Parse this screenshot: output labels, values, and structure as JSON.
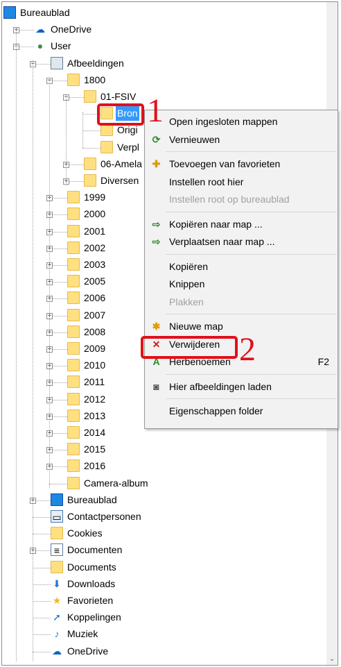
{
  "tree": {
    "items": [
      {
        "label": "Bureaublad",
        "icon": "desktop-icon",
        "level": 0,
        "expander": "",
        "selected": false
      },
      {
        "label": "OneDrive",
        "icon": "onedrive-cloud-icon",
        "level": 1,
        "expander": "+",
        "selected": false
      },
      {
        "label": "User",
        "icon": "user-icon",
        "level": 1,
        "expander": "-",
        "selected": false
      },
      {
        "label": "Afbeeldingen",
        "icon": "pictures-folder-icon",
        "level": 2,
        "expander": "-",
        "selected": false
      },
      {
        "label": "1800",
        "icon": "folder-icon",
        "level": 3,
        "expander": "-",
        "selected": false
      },
      {
        "label": "01-FSIV",
        "icon": "folder-icon",
        "level": 4,
        "expander": "-",
        "selected": false
      },
      {
        "label": "Bron",
        "icon": "folder-icon",
        "level": 5,
        "expander": "",
        "selected": true
      },
      {
        "label": "Origi",
        "icon": "folder-icon",
        "level": 5,
        "expander": "",
        "selected": false
      },
      {
        "label": "Verpl",
        "icon": "folder-icon",
        "level": 5,
        "expander": "",
        "selected": false
      },
      {
        "label": "06-Amela",
        "icon": "folder-icon",
        "level": 4,
        "expander": "+",
        "selected": false
      },
      {
        "label": "Diversen",
        "icon": "folder-icon",
        "level": 4,
        "expander": "+",
        "selected": false
      },
      {
        "label": "1999",
        "icon": "folder-icon",
        "level": 3,
        "expander": "+",
        "selected": false
      },
      {
        "label": "2000",
        "icon": "folder-icon",
        "level": 3,
        "expander": "+",
        "selected": false
      },
      {
        "label": "2001",
        "icon": "folder-icon",
        "level": 3,
        "expander": "+",
        "selected": false
      },
      {
        "label": "2002",
        "icon": "folder-icon",
        "level": 3,
        "expander": "+",
        "selected": false
      },
      {
        "label": "2003",
        "icon": "folder-icon",
        "level": 3,
        "expander": "+",
        "selected": false
      },
      {
        "label": "2005",
        "icon": "folder-icon",
        "level": 3,
        "expander": "+",
        "selected": false
      },
      {
        "label": "2006",
        "icon": "folder-icon",
        "level": 3,
        "expander": "+",
        "selected": false
      },
      {
        "label": "2007",
        "icon": "folder-icon",
        "level": 3,
        "expander": "+",
        "selected": false
      },
      {
        "label": "2008",
        "icon": "folder-icon",
        "level": 3,
        "expander": "+",
        "selected": false
      },
      {
        "label": "2009",
        "icon": "folder-icon",
        "level": 3,
        "expander": "+",
        "selected": false
      },
      {
        "label": "2010",
        "icon": "folder-icon",
        "level": 3,
        "expander": "+",
        "selected": false
      },
      {
        "label": "2011",
        "icon": "folder-icon",
        "level": 3,
        "expander": "+",
        "selected": false
      },
      {
        "label": "2012",
        "icon": "folder-icon",
        "level": 3,
        "expander": "+",
        "selected": false
      },
      {
        "label": "2013",
        "icon": "folder-icon",
        "level": 3,
        "expander": "+",
        "selected": false
      },
      {
        "label": "2014",
        "icon": "folder-icon",
        "level": 3,
        "expander": "+",
        "selected": false
      },
      {
        "label": "2015",
        "icon": "folder-icon",
        "level": 3,
        "expander": "+",
        "selected": false
      },
      {
        "label": "2016",
        "icon": "folder-icon",
        "level": 3,
        "expander": "+",
        "selected": false
      },
      {
        "label": "Camera-album",
        "icon": "folder-icon",
        "level": 3,
        "expander": "",
        "selected": false
      },
      {
        "label": "Bureaublad",
        "icon": "desktop-icon",
        "level": 2,
        "expander": "+",
        "selected": false
      },
      {
        "label": "Contactpersonen",
        "icon": "contacts-icon",
        "level": 2,
        "expander": "",
        "selected": false
      },
      {
        "label": "Cookies",
        "icon": "folder-icon",
        "level": 2,
        "expander": "",
        "selected": false
      },
      {
        "label": "Documenten",
        "icon": "documents-icon",
        "level": 2,
        "expander": "+",
        "selected": false
      },
      {
        "label": "Documents",
        "icon": "folder-icon",
        "level": 2,
        "expander": "",
        "selected": false
      },
      {
        "label": "Downloads",
        "icon": "downloads-icon",
        "level": 2,
        "expander": "",
        "selected": false
      },
      {
        "label": "Favorieten",
        "icon": "favorites-star-icon",
        "level": 2,
        "expander": "",
        "selected": false
      },
      {
        "label": "Koppelingen",
        "icon": "links-icon",
        "level": 2,
        "expander": "",
        "selected": false
      },
      {
        "label": "Muziek",
        "icon": "music-icon",
        "level": 2,
        "expander": "",
        "selected": false
      },
      {
        "label": "OneDrive",
        "icon": "onedrive-cloud-icon",
        "level": 2,
        "expander": "",
        "selected": false
      }
    ]
  },
  "context_menu": {
    "items": [
      {
        "type": "item",
        "label": "Open ingesloten mappen",
        "icon": "",
        "key": "",
        "disabled": false,
        "name": "menu-open-subfolders"
      },
      {
        "type": "item",
        "label": "Vernieuwen",
        "icon": "refresh-icon",
        "key": "",
        "disabled": false,
        "name": "menu-refresh"
      },
      {
        "type": "sep"
      },
      {
        "type": "item",
        "label": "Toevoegen van favorieten",
        "icon": "add-favorite-icon",
        "key": "",
        "disabled": false,
        "name": "menu-add-favorites"
      },
      {
        "type": "item",
        "label": "Instellen root hier",
        "icon": "",
        "key": "",
        "disabled": false,
        "name": "menu-set-root-here"
      },
      {
        "type": "item",
        "label": "Instellen root op bureaublad",
        "icon": "",
        "key": "",
        "disabled": true,
        "name": "menu-set-root-desktop"
      },
      {
        "type": "sep"
      },
      {
        "type": "item",
        "label": "Kopiëren naar map ...",
        "icon": "copy-to-folder-icon",
        "key": "",
        "disabled": false,
        "name": "menu-copy-to-folder"
      },
      {
        "type": "item",
        "label": "Verplaatsen naar map ...",
        "icon": "move-to-folder-icon",
        "key": "",
        "disabled": false,
        "name": "menu-move-to-folder"
      },
      {
        "type": "sep"
      },
      {
        "type": "item",
        "label": "Kopiëren",
        "icon": "",
        "key": "",
        "disabled": false,
        "name": "menu-copy"
      },
      {
        "type": "item",
        "label": "Knippen",
        "icon": "",
        "key": "",
        "disabled": false,
        "name": "menu-cut"
      },
      {
        "type": "item",
        "label": "Plakken",
        "icon": "",
        "key": "",
        "disabled": true,
        "name": "menu-paste"
      },
      {
        "type": "sep"
      },
      {
        "type": "item",
        "label": "Nieuwe map",
        "icon": "new-folder-icon",
        "key": "",
        "disabled": false,
        "name": "menu-new-folder"
      },
      {
        "type": "item",
        "label": "Verwijderen",
        "icon": "delete-x-icon",
        "key": "",
        "disabled": false,
        "name": "menu-delete"
      },
      {
        "type": "item",
        "label": "Herbenoemen",
        "icon": "rename-icon",
        "key": "F2",
        "disabled": false,
        "name": "menu-rename"
      },
      {
        "type": "sep"
      },
      {
        "type": "item",
        "label": "Hier afbeeldingen laden",
        "icon": "camera-icon",
        "key": "",
        "disabled": false,
        "name": "menu-load-images-here"
      },
      {
        "type": "sep"
      },
      {
        "type": "item",
        "label": "Eigenschappen folder",
        "icon": "",
        "key": "",
        "disabled": false,
        "name": "menu-folder-properties"
      }
    ]
  },
  "annotations": {
    "step1": "1",
    "step2": "2"
  },
  "colors": {
    "selection": "#3399ff",
    "annotation_red": "#e0101a",
    "folder_yellow": "#ffe081",
    "menu_background": "#f2f2f2"
  }
}
